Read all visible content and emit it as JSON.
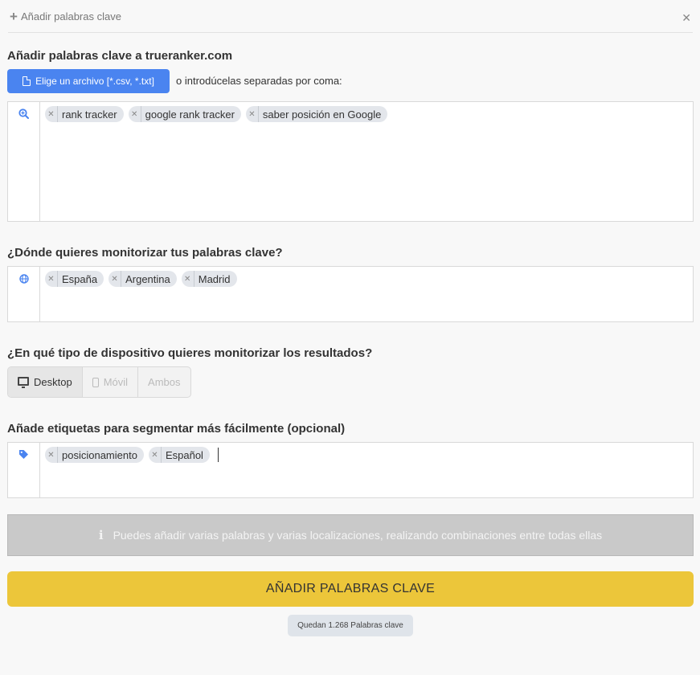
{
  "header": {
    "title": "Añadir palabras clave",
    "plus_icon": "plus-icon",
    "close_icon": "close-icon"
  },
  "keywords_section": {
    "title": "Añadir palabras clave a trueranker.com",
    "file_button_label": "Elige un archivo [*.csv, *.txt]",
    "or_text": "o introdúcelas separadas por coma:",
    "icon": "search-plus-icon",
    "tags": [
      "rank tracker",
      "google rank tracker",
      "saber posición en Google"
    ]
  },
  "locations_section": {
    "title": "¿Dónde quieres monitorizar tus palabras clave?",
    "icon": "globe-icon",
    "tags": [
      "España",
      "Argentina",
      "Madrid"
    ]
  },
  "device_section": {
    "title": "¿En qué tipo de dispositivo quieres monitorizar los resultados?",
    "options": [
      {
        "label": "Desktop",
        "icon": "monitor-icon",
        "selected": true
      },
      {
        "label": "Móvil",
        "icon": "phone-icon",
        "selected": false
      },
      {
        "label": "Ambos",
        "selected": false
      }
    ]
  },
  "tags_section": {
    "title": "Añade etiquetas para segmentar más fácilmente (opcional)",
    "icon": "tag-icon",
    "tags": [
      "posicionamiento",
      "Español"
    ]
  },
  "info": {
    "icon": "info-icon",
    "text": "Puedes añadir varias palabras y varias localizaciones, realizando combinaciones entre todas ellas"
  },
  "submit_label": "AÑADIR PALABRAS CLAVE",
  "remaining": "Quedan 1.268 Palabras clave",
  "colors": {
    "accent_blue": "#4a84f0",
    "submit_yellow": "#ecc63a",
    "info_grey": "#c9c9c9"
  }
}
